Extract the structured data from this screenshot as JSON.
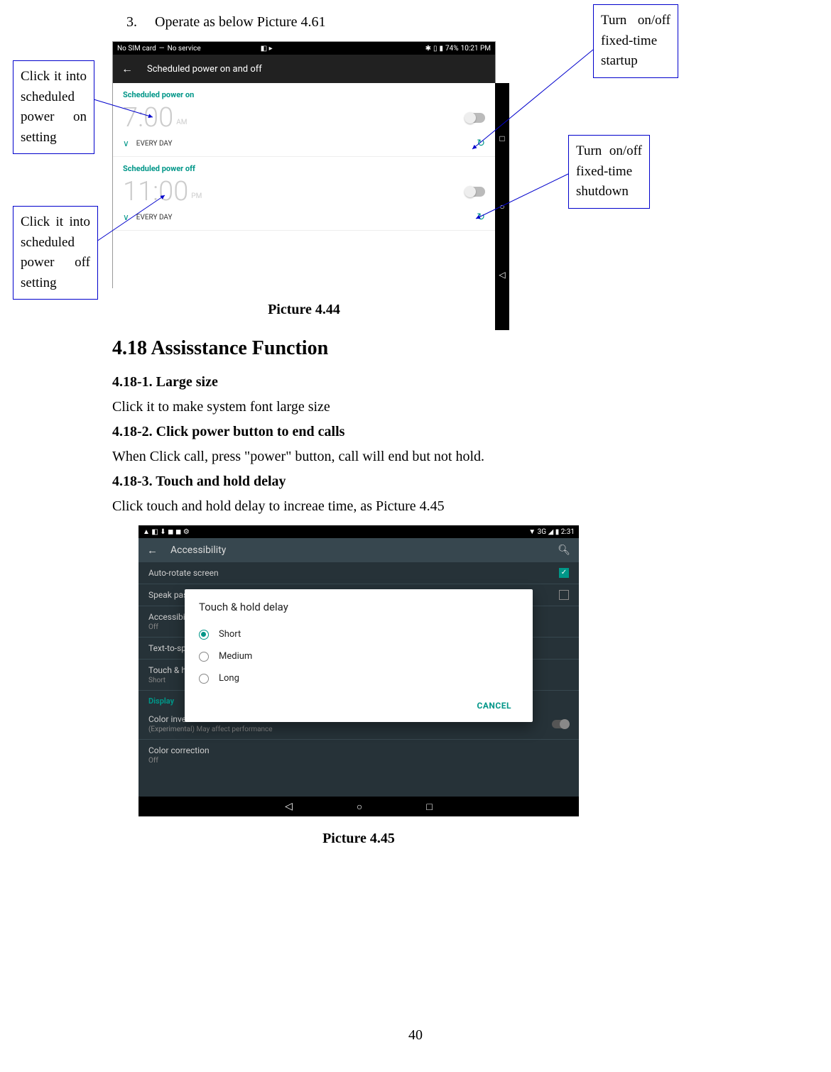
{
  "step_num": "3.",
  "step_text": "Operate as below Picture 4.61",
  "callouts": {
    "c1": "Click it into scheduled power on setting",
    "c2": "Click it into scheduled power off setting",
    "c3": "Turn on/off fixed-time startup",
    "c4": "Turn on/off fixed-time shutdown"
  },
  "shot1": {
    "status_left_sim": "No SIM card",
    "status_left_service": "No service",
    "status_battery": "74%",
    "status_time": "10:21 PM",
    "title": "Scheduled power on and off",
    "sec_on": "Scheduled power on",
    "sec_off": "Scheduled power off",
    "time_on": "7:00",
    "ampm_on": "AM",
    "time_off": "11:00",
    "ampm_off": "PM",
    "every": "EVERY DAY"
  },
  "caption1": "Picture 4.44",
  "h2": "4.18 Assisstance Function",
  "sub1_h": "4.18-1. Large size",
  "sub1_t": "Click it to make system font large size",
  "sub2_h": "4.18-2. Click power button to end calls",
  "sub2_t": "When Click call, press \"power\" button, call will end but not hold.",
  "sub3_h": "4.18-3. Touch and hold delay",
  "sub3_t": "Click touch and hold delay to increae time, as Picture 4.45",
  "shot2": {
    "status_right_net": "3G",
    "status_right_time": "2:31",
    "title": "Accessibility",
    "rows": {
      "auto_rotate": "Auto-rotate screen",
      "speak_pw": "Speak passwords",
      "acc_shortcut": "Accessibility shortcut",
      "off": "Off",
      "tts": "Text-to-speech output",
      "touch_hold": "Touch & hold delay",
      "short": "Short",
      "display": "Display",
      "color_inv": "Color inversion",
      "color_inv_sub": "(Experimental) May affect performance",
      "color_corr": "Color correction"
    },
    "dialog": {
      "title": "Touch & hold delay",
      "opt1": "Short",
      "opt2": "Medium",
      "opt3": "Long",
      "cancel": "CANCEL"
    }
  },
  "caption2": "Picture 4.45",
  "page_num": "40"
}
